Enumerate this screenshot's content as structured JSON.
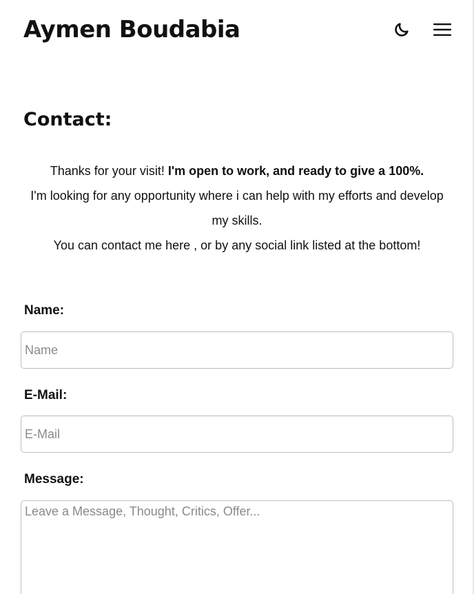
{
  "header": {
    "site_title": "Aymen Boudabia",
    "theme_toggle_icon": "moon-icon",
    "menu_icon": "hamburger-menu-icon"
  },
  "contact": {
    "title": "Contact:",
    "intro_thanks": "Thanks for your visit!",
    "intro_open": "I'm open to work, and ready to give a 100%.",
    "intro_looking": "I'm looking for any opportunity where i can help with my efforts and develop my skills.",
    "intro_contact_prefix": "You can contact me",
    "intro_contact_link": "here",
    "intro_contact_suffix": ", or by any social link listed at the bottom!"
  },
  "form": {
    "name_label": "Name:",
    "name_placeholder": "Name",
    "email_label": "E-Mail:",
    "email_placeholder": "E-Mail",
    "message_label": "Message:",
    "message_placeholder": "Leave a Message, Thought, Critics, Offer..."
  }
}
